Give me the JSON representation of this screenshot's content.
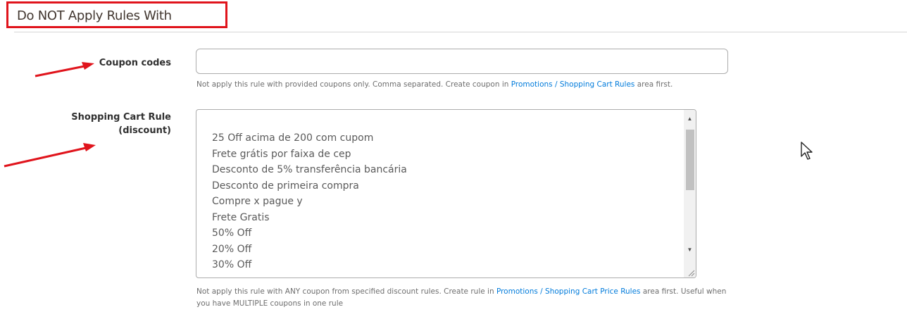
{
  "section": {
    "title": "Do NOT Apply Rules With"
  },
  "coupon_codes": {
    "label": "Coupon codes",
    "value": "",
    "note_prefix": "Not apply this rule with provided coupons only. Comma separated. Create coupon in ",
    "note_link": "Promotions / Shopping Cart Rules",
    "note_suffix": " area first."
  },
  "cart_rule": {
    "label_line1": "Shopping Cart Rule",
    "label_line2": "(discount)",
    "options": [
      "25 Off acima de 200 com cupom",
      "Frete grátis por faixa de cep",
      "Desconto de 5% transferência bancária",
      "Desconto de primeira compra",
      "Compre x pague y",
      "Frete Gratis",
      "50% Off",
      "20% Off",
      "30% Off"
    ],
    "note_prefix": "Not apply this rule with ANY coupon from specified discount rules. Create rule in ",
    "note_link": "Promotions / Shopping Cart Price Rules",
    "note_suffix": " area first. Useful when you have MULTIPLE coupons in one rule"
  },
  "colors": {
    "highlight": "#e0141c",
    "link": "#007bdb",
    "annotation_arrow": "#e0141c"
  },
  "icons": {
    "scroll_up": "triangle-up",
    "scroll_down": "triangle-down",
    "cursor": "mouse-pointer",
    "resize": "resize-grip"
  }
}
